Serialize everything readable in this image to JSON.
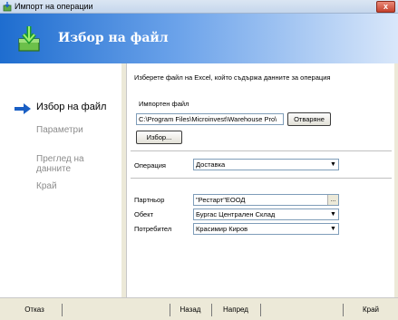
{
  "window": {
    "title": "Импорт на операции",
    "title_icon": "app-icon",
    "close_label": "x"
  },
  "banner": {
    "title": "Избор на файл",
    "icon": "download-arrow-icon"
  },
  "sidebar": {
    "steps": [
      {
        "label": "Избор на файл",
        "active": true
      },
      {
        "label": "Параметри",
        "active": false
      },
      {
        "label": "Преглед на данните",
        "active": false
      },
      {
        "label": "Край",
        "active": false
      }
    ],
    "current_icon": "right-arrow-icon"
  },
  "main": {
    "hint": "Изберете файл на Excel, който съдържа данните за операция",
    "imported_file_label": "Импортен файл",
    "imported_file_value": "C:\\Program Files\\Microinvest\\Warehouse Pro\\",
    "open_button": "Отваряне",
    "choose_button": "Избор...",
    "operation_label": "Операция",
    "operation_value": "Доставка",
    "partner_label": "Партньор",
    "partner_value": "\"Рестарт\"ЕООД",
    "partner_browse": "...",
    "object_label": "Обект",
    "object_value": "Бургас Централен Склад",
    "user_label": "Потребител",
    "user_value": "Красимир Киров"
  },
  "footer": {
    "cancel": "Отказ",
    "back": "Назад",
    "next": "Напред",
    "finish": "Край"
  },
  "colors": {
    "banner_start": "#1e6dcf",
    "banner_end": "#d9e7fa",
    "active_arrow": "#1a5fc4",
    "field_border": "#7f9db9"
  }
}
